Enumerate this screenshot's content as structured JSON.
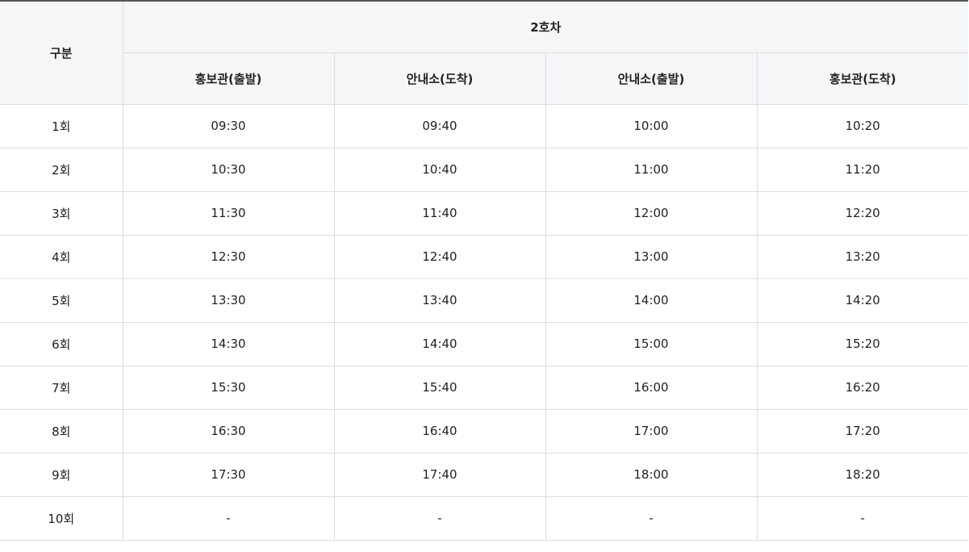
{
  "table": {
    "corner_header": "구분",
    "group_header": "2호차",
    "columns": [
      "홍보관(출발)",
      "안내소(도착)",
      "안내소(출발)",
      "홍보관(도착)"
    ],
    "rows": [
      {
        "label": "1회",
        "cells": [
          "09:30",
          "09:40",
          "10:00",
          "10:20"
        ]
      },
      {
        "label": "2회",
        "cells": [
          "10:30",
          "10:40",
          "11:00",
          "11:20"
        ]
      },
      {
        "label": "3회",
        "cells": [
          "11:30",
          "11:40",
          "12:00",
          "12:20"
        ]
      },
      {
        "label": "4회",
        "cells": [
          "12:30",
          "12:40",
          "13:00",
          "13:20"
        ]
      },
      {
        "label": "5회",
        "cells": [
          "13:30",
          "13:40",
          "14:00",
          "14:20"
        ]
      },
      {
        "label": "6회",
        "cells": [
          "14:30",
          "14:40",
          "15:00",
          "15:20"
        ]
      },
      {
        "label": "7회",
        "cells": [
          "15:30",
          "15:40",
          "16:00",
          "16:20"
        ]
      },
      {
        "label": "8회",
        "cells": [
          "16:30",
          "16:40",
          "17:00",
          "17:20"
        ]
      },
      {
        "label": "9회",
        "cells": [
          "17:30",
          "17:40",
          "18:00",
          "18:20"
        ]
      },
      {
        "label": "10회",
        "cells": [
          "-",
          "-",
          "-",
          "-"
        ]
      }
    ]
  }
}
